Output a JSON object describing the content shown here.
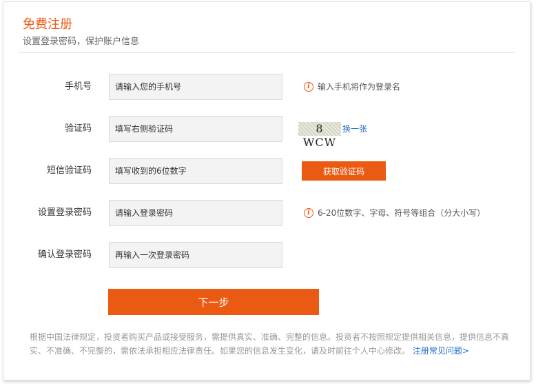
{
  "header": {
    "title": "免费注册",
    "subtitle": "设置登录密码，保护账户信息"
  },
  "form": {
    "phone": {
      "label": "手机号",
      "placeholder": "请输入您的手机号",
      "hint": "输入手机将作为登录名"
    },
    "captcha": {
      "label": "验证码",
      "placeholder": "填写右侧验证码",
      "image_text": "8 WCW",
      "swap_label": "换一张"
    },
    "sms": {
      "label": "短信验证码",
      "placeholder": "填写收到的6位数字",
      "button": "获取验证码"
    },
    "password": {
      "label": "设置登录密码",
      "placeholder": "请输入登录密码",
      "hint": "6-20位数字、字母、符号等组合（分大小写）"
    },
    "confirm": {
      "label": "确认登录密码",
      "placeholder": "再输入一次登录密码"
    },
    "next_button": "下一步"
  },
  "notice": {
    "text": "根据中国法律规定，投资者购买产品或接受服务，需提供真实、准确、完整的信息。投资者不按照规定提供相关信息，提供信息不真实、不准确、不完整的，需依法承担相应法律责任。如果您的信息发生变化，请及时前往个人中心修改。",
    "faq_link": "注册常见问题>"
  },
  "icons": {
    "info": "info-icon"
  },
  "colors": {
    "accent": "#eb5a12",
    "link": "#1f6ecb"
  }
}
